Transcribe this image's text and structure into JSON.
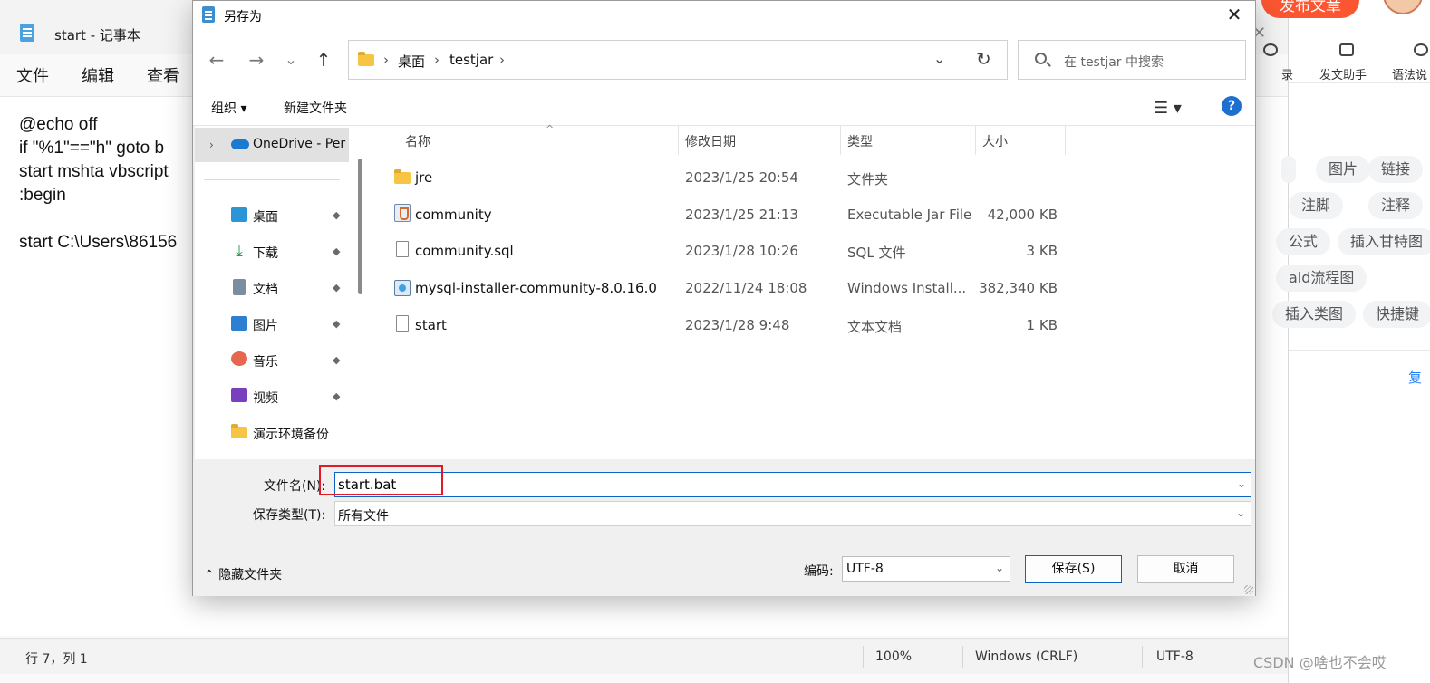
{
  "notepad": {
    "title": "start - 记事本",
    "menu": [
      "文件",
      "编辑",
      "查看"
    ],
    "lines": [
      "@echo off",
      "if \"%1\"==\"h\" goto b",
      "start mshta vbscript",
      ":begin",
      "",
      "start C:\\Users\\86156"
    ],
    "status": {
      "position": "行 7，列 1",
      "zoom": "100%",
      "line_ending": "Windows (CRLF)",
      "encoding": "UTF-8"
    },
    "close_glyph": "✕"
  },
  "csdn": {
    "publish_button": "发布文章",
    "toolbar": [
      {
        "label": "录",
        "icon": "gear-icon"
      },
      {
        "label": "发文助手",
        "icon": "assistant-icon"
      },
      {
        "label": "语法说",
        "icon": "help-icon"
      }
    ],
    "tags": [
      "图片",
      "链接",
      "注脚",
      "注释",
      "公式",
      "插入甘特图",
      "aid流程图",
      "插入类图",
      "快捷键"
    ],
    "copy_link": "复",
    "watermark": "CSDN @啥也不会哎"
  },
  "dialog": {
    "title": "另存为",
    "close_glyph": "✕",
    "nav": {
      "back": "←",
      "forward": "→",
      "recent": "⌄",
      "up": "↑"
    },
    "breadcrumb": [
      "桌面",
      "testjar"
    ],
    "breadcrumb_sep": "›",
    "refresh_glyph": "↻",
    "dropdown_glyph": "⌄",
    "search_placeholder": "在 testjar 中搜索",
    "commands": {
      "organize": "组织 ▾",
      "new_folder": "新建文件夹",
      "view": "☰ ▾",
      "help": "?"
    },
    "nav_pane": {
      "onedrive": "OneDrive - Per",
      "quick_access": [
        {
          "label": "桌面",
          "icon": "desktop-icon",
          "color": "#2b95d6",
          "pinned": true
        },
        {
          "label": "下载",
          "icon": "download-icon",
          "color": "#2f9b59",
          "pinned": true
        },
        {
          "label": "文档",
          "icon": "document-icon",
          "color": "#7b8da3",
          "pinned": true
        },
        {
          "label": "图片",
          "icon": "picture-icon",
          "color": "#2c7fd1",
          "pinned": true
        },
        {
          "label": "音乐",
          "icon": "music-icon",
          "color": "#e6664e",
          "pinned": true
        },
        {
          "label": "视频",
          "icon": "video-icon",
          "color": "#7a3fbf",
          "pinned": true
        },
        {
          "label": "演示环境备份",
          "icon": "folder-icon",
          "color": "#f6c543",
          "pinned": false
        }
      ],
      "pin_glyph": "📌"
    },
    "columns": {
      "name": "名称",
      "modified": "修改日期",
      "type": "类型",
      "size": "大小"
    },
    "files": [
      {
        "name": "jre",
        "modified": "2023/1/25 20:54",
        "type": "文件夹",
        "size": "",
        "icon": "folder-icon"
      },
      {
        "name": "community",
        "modified": "2023/1/25 21:13",
        "type": "Executable Jar File",
        "size": "42,000 KB",
        "icon": "jar-file-icon"
      },
      {
        "name": "community.sql",
        "modified": "2023/1/28 10:26",
        "type": "SQL 文件",
        "size": "3 KB",
        "icon": "sql-file-icon"
      },
      {
        "name": "mysql-installer-community-8.0.16.0",
        "modified": "2022/11/24 18:08",
        "type": "Windows Install...",
        "size": "382,340 KB",
        "icon": "installer-file-icon"
      },
      {
        "name": "start",
        "modified": "2023/1/28 9:48",
        "type": "文本文档",
        "size": "1 KB",
        "icon": "text-file-icon"
      }
    ],
    "filename_label": "文件名(N):",
    "filename_value": "start.bat",
    "filetype_label": "保存类型(T):",
    "filetype_value": "所有文件",
    "hide_folders": "隐藏文件夹",
    "encoding_label": "编码:",
    "encoding_value": "UTF-8",
    "save_button": "保存(S)",
    "cancel_button": "取消",
    "highlight_color": "#e11a2b"
  }
}
